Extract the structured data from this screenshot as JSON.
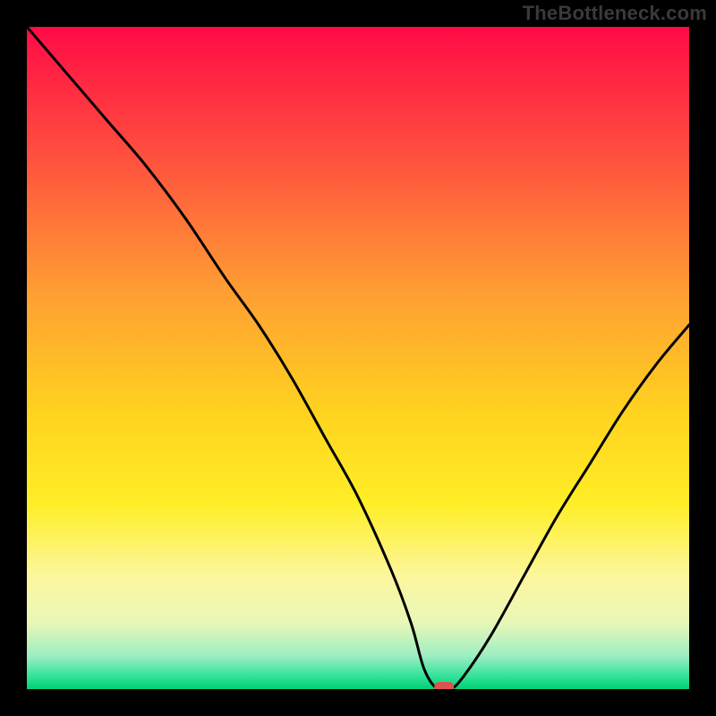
{
  "watermark": {
    "text": "TheBottleneck.com"
  },
  "chart_data": {
    "type": "line",
    "title": "",
    "xlabel": "",
    "ylabel": "",
    "xlim": [
      0,
      100
    ],
    "ylim": [
      0,
      100
    ],
    "grid": false,
    "legend": false,
    "description": "Bottleneck curve over a red-to-green vertical gradient. High y = high bottleneck (red). A single red marker near the minimum.",
    "series": [
      {
        "name": "bottleneck-curve",
        "x": [
          0,
          6,
          12,
          18,
          24,
          30,
          35,
          40,
          45,
          50,
          55,
          58,
          60,
          62,
          64,
          66,
          70,
          75,
          80,
          85,
          90,
          95,
          100
        ],
        "y": [
          100,
          93,
          86,
          79,
          71,
          62,
          55,
          47,
          38,
          29,
          18,
          10,
          3,
          0,
          0,
          2,
          8,
          17,
          26,
          34,
          42,
          49,
          55
        ]
      }
    ],
    "marker": {
      "x": 63,
      "y": 0,
      "color": "#d9534f"
    },
    "gradient_stops": [
      {
        "offset": 0,
        "color": "#ff0b46"
      },
      {
        "offset": 18,
        "color": "#ff4a3f"
      },
      {
        "offset": 40,
        "color": "#ff9e33"
      },
      {
        "offset": 58,
        "color": "#ffd21f"
      },
      {
        "offset": 72,
        "color": "#ffee26"
      },
      {
        "offset": 83,
        "color": "#fcf79e"
      },
      {
        "offset": 90,
        "color": "#e9f7b8"
      },
      {
        "offset": 95,
        "color": "#9ceec2"
      },
      {
        "offset": 98,
        "color": "#34e39a"
      },
      {
        "offset": 100,
        "color": "#00d074"
      }
    ]
  }
}
